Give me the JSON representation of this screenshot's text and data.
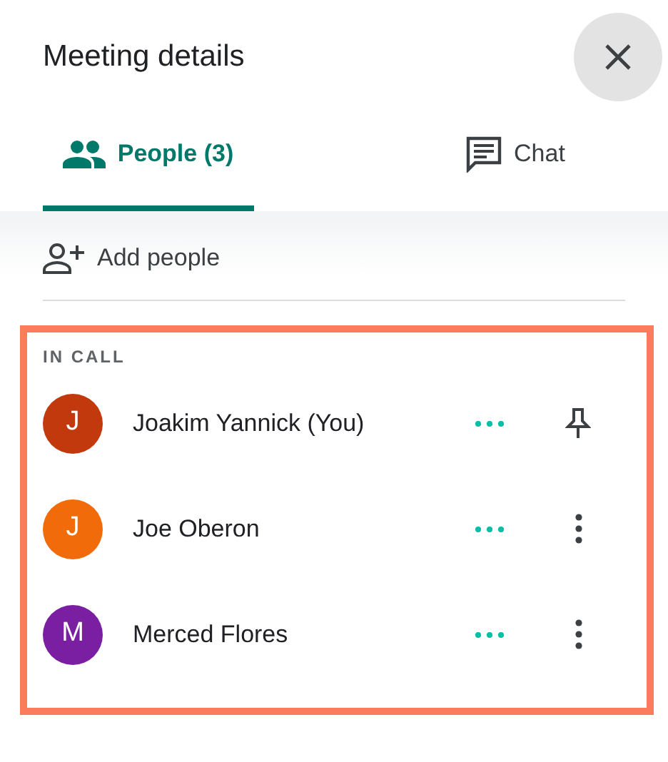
{
  "title": "Meeting details",
  "tabs": [
    {
      "label": "People (3)",
      "kind": "people",
      "selected": true
    },
    {
      "label": "Chat",
      "kind": "chat",
      "selected": false
    }
  ],
  "add_people": {
    "label": "Add people"
  },
  "section": {
    "heading": "IN CALL"
  },
  "participants": [
    {
      "initial": "J",
      "name": "Joakim Yannick (You)",
      "color": "#c1390d",
      "kind": "pin"
    },
    {
      "initial": "J",
      "name": "Joe Oberon",
      "color": "#f26b0b",
      "kind": "menu"
    },
    {
      "initial": "M",
      "name": "Merced Flores",
      "color": "#7b1fa2",
      "kind": "menu"
    }
  ]
}
